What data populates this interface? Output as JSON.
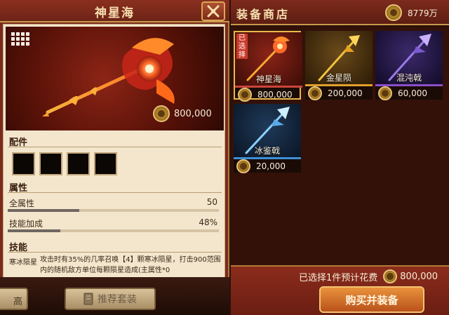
{
  "detail": {
    "title": "神星海",
    "price": "800,000",
    "sections": {
      "parts": "配件",
      "attributes": "属性",
      "skills": "技能"
    },
    "attributes": [
      {
        "label": "全属性",
        "value": "50",
        "fraction": 0.34
      },
      {
        "label": "技能加成",
        "value": "48%",
        "fraction": 0.25
      }
    ],
    "skill": {
      "name": "寒冰陨星",
      "desc": "攻击时有35%的几率召唤【4】颗寒冰陨星，打击900范围内的随机敌方单位每颗陨星造成(主属性*0"
    },
    "footer": {
      "partial_button": "高",
      "recommend_button": "推荐套装"
    }
  },
  "shop": {
    "title": "装备商店",
    "money": "8779万",
    "selected_badge": "已选择",
    "items": [
      {
        "name": "神星海",
        "price": "800,000",
        "selected": true,
        "strip_color": "#c9453a",
        "theme": "fire"
      },
      {
        "name": "金星陨",
        "price": "200,000",
        "selected": false,
        "strip_color": "#e0a02c",
        "theme": "gold"
      },
      {
        "name": "混沌戟",
        "price": "60,000",
        "selected": false,
        "strip_color": "#8a4fc8",
        "theme": "purple"
      },
      {
        "name": "冰鉴戟",
        "price": "20,000",
        "selected": false,
        "strip_color": "#3f8fd6",
        "theme": "ice"
      }
    ],
    "summary_text": "已选择1件预计花费",
    "summary_price": "800,000",
    "buy_button": "购买并装备"
  }
}
